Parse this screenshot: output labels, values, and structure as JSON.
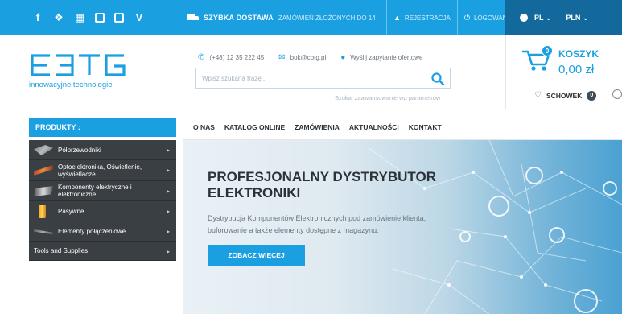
{
  "colors": {
    "brand": "#1a9fe0",
    "dark_bar": "#13699c",
    "sidebar": "#3a3f44",
    "text": "#2b3136"
  },
  "topbar": {
    "social": [
      {
        "name": "facebook-icon",
        "glyph": "f"
      },
      {
        "name": "twitter-icon",
        "glyph": "y"
      },
      {
        "name": "youtube-icon",
        "glyph": "▤"
      },
      {
        "name": "instagram-icon",
        "glyph": ""
      },
      {
        "name": "linkedin-icon",
        "glyph": ""
      },
      {
        "name": "vimeo-icon",
        "glyph": "V"
      }
    ],
    "shipping_bold": "SZYBKA DOSTAWA",
    "shipping_sub": "ZAMÓWIEŃ ZŁOŻONYCH DO 14",
    "register": "REJESTRACJA",
    "login": "LOGOWANIE",
    "language": "PL",
    "currency": "PLN"
  },
  "header": {
    "logo_text": "EBTG",
    "logo_tagline": "innowacyjne technologie",
    "phone": "(+48) 12 35 222 45",
    "email": "bok@cbtg.pl",
    "inquiry": "Wyślij zapytanie ofertowe",
    "search_placeholder": "Wpisz szukaną frazę...",
    "advanced_search": "Szukaj zaawansowanie wg parametrów"
  },
  "cart": {
    "badge": "0",
    "title": "KOSZYK",
    "value": "0,00 zł",
    "wishlist_label": "SCHOWEK",
    "wishlist_count": "0"
  },
  "sidebar": {
    "heading": "PRODUKTY :",
    "items": [
      {
        "label": "Półprzewodniki"
      },
      {
        "label": "Optoelektronika, Oświetlenie, wyświetlacze"
      },
      {
        "label": "Komponenty elektryczne i elektroniczne"
      },
      {
        "label": "Pasywne"
      },
      {
        "label": "Elementy połączeniowe"
      },
      {
        "label": "Tools and Supplies"
      }
    ]
  },
  "nav": [
    "O NAS",
    "KATALOG ONLINE",
    "ZAMÓWIENIA",
    "AKTUALNOŚCI",
    "KONTAKT"
  ],
  "hero": {
    "title_line1": "PROFESJONALNY DYSTRYBUTOR",
    "title_line2": "ELEKTRONIKI",
    "desc_line1": "Dystrybucja Komponentów Elektronicznych pod zamówienie klienta,",
    "desc_line2": "buforowanie a także elementy dostępne z magazynu.",
    "button": "ZOBACZ WIĘCEJ"
  }
}
